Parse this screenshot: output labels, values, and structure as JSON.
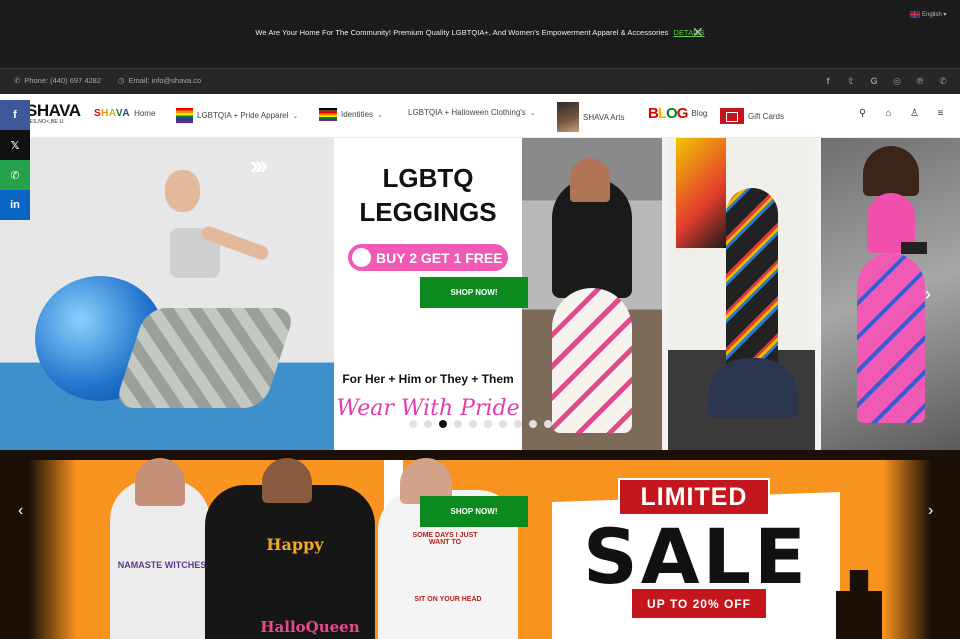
{
  "announcement": {
    "text": "We Are Your Home For The Community! Premium Quality LGBTQIA+, And Women's Empowerment Apparel & Accessories",
    "link": "DETAILS",
    "close": "✕",
    "language": "English ▾"
  },
  "topbar": {
    "phone": "Phone: (440) 697 4282",
    "email": "Email: info@shava.co",
    "socials": [
      "facebook-icon",
      "twitter-icon",
      "google-icon",
      "instagram-icon",
      "pinterest-icon",
      "whatsapp-icon"
    ]
  },
  "nav": {
    "logo": "SHAVA",
    "logo_tagline": "YES,NO<,BE U.",
    "items": [
      {
        "icon_text": "SHAVA",
        "label": "Home"
      },
      {
        "label": "LGBTQIA + Pride Apparel"
      },
      {
        "label": "Identities"
      },
      {
        "label": "LGBTQIA + Halloween Clothing's"
      },
      {
        "label": "SHAVA Arts"
      },
      {
        "icon_text": "BLOG",
        "label": "Blog"
      },
      {
        "label": "Gift Cards"
      }
    ]
  },
  "share": [
    "f",
    "𝕏",
    "✆",
    "in"
  ],
  "hero": {
    "title_line1": "LGBTQ",
    "title_line2": "LEGGINGS",
    "promo": "BUY 2 GET 1 FREE",
    "cta": "SHOP NOW!",
    "tagline": "For Her + Him or They + Them",
    "script": "Wear With Pride",
    "slide_count": 10,
    "active_slide": 3
  },
  "halloween": {
    "cta": "SHOP NOW!",
    "limited": "LIMITED",
    "sale": "SALE",
    "discount": "UP TO 20% OFF",
    "shirt1": "NAMASTE WITCHES",
    "shirt2_top": "Happy",
    "shirt2_bottom": "HalloQueen",
    "shirt3_top": "SOME DAYS I JUST WANT TO",
    "shirt3_bottom": "SIT ON YOUR HEAD"
  },
  "colors": {
    "accent_green": "#0d8a1e",
    "link_green": "#5fce47",
    "pink": "#f05ab4",
    "sale_red": "#c4171d",
    "halloween_orange": "#f7931e"
  }
}
